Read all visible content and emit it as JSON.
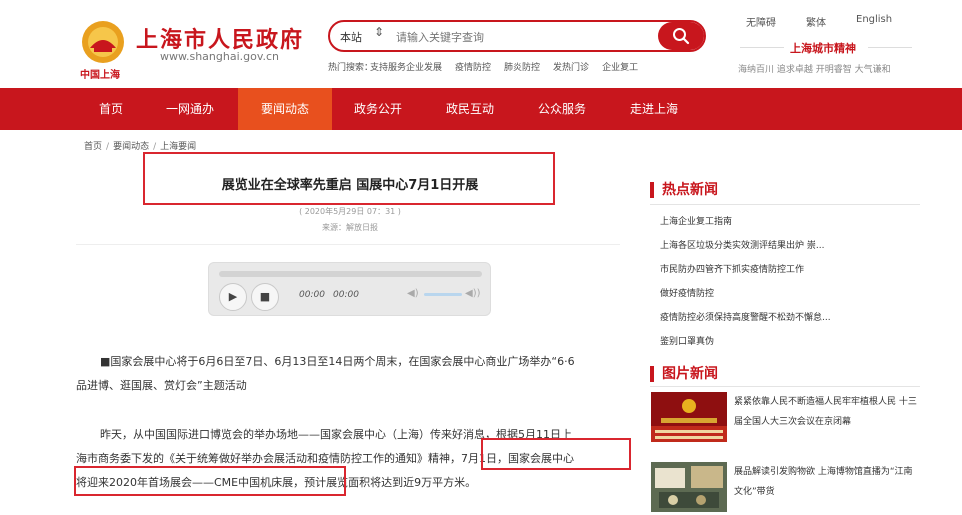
{
  "header": {
    "site_title": "上海市人民政府",
    "site_url": "www.shanghai.gov.cn",
    "emblem_caption": "中国上海",
    "search": {
      "scope": "本站",
      "placeholder": "请输入关键字查询",
      "hot_label": "热门搜索：",
      "hot_links": [
        "支持服务企业发展",
        "疫情防控",
        "肺炎防控",
        "发热门诊",
        "企业复工"
      ]
    },
    "top_links": [
      "无障碍",
      "繁体",
      "English"
    ],
    "spirit_title": "上海城市精神",
    "spirit_text": "海纳百川 追求卓越 开明睿智 大气谦和"
  },
  "nav": {
    "items": [
      "首页",
      "一网通办",
      "要闻动态",
      "政务公开",
      "政民互动",
      "公众服务",
      "走进上海"
    ],
    "active": "要闻动态"
  },
  "breadcrumb": [
    "首页",
    "要闻动态",
    "上海要闻"
  ],
  "article": {
    "title": "展览业在全球率先重启 国展中心7月1日开展",
    "date": "( 2020年5月29日 07：31 )",
    "source": "来源：解放日报",
    "player": {
      "current_time": "00:00",
      "duration": "00:00"
    },
    "p1_line1": "■国家会展中心将于6月6日至7日、6月13日至14日两个周末，在国家会展中心商业广场举办“6·6",
    "p1_line2": "品进博、逛国展、赏灯会”主题活动",
    "p2_line1": "昨天，从中国国际进口博览会的举办场地——国家会展中心（上海）传来好消息，根据5月11日上",
    "p2_line2": "海市商务委下发的《关于统筹做好举办会展活动和疫情防控工作的通知》精神，7月1日，国家会展中心",
    "p2_line3": "将迎来2020年首场展会——CME中国机床展，预计展览面积将达到近9万平方米。"
  },
  "sidebar": {
    "hot_news_title": "热点新闻",
    "hot_news": [
      "上海企业复工指南",
      "上海各区垃圾分类实效测评结果出炉 崇...",
      "市民防办四管齐下抓实疫情防控工作",
      "做好疫情防控",
      "疫情防控必须保持高度警醒不松劲不懈怠...",
      "鉴别口罩真伪"
    ],
    "picture_news_title": "图片新闻",
    "picture_news": [
      "紧紧依靠人民不断造福人民牢牢植根人民 十三届全国人大三次会议在京闭幕",
      "展品解读引发购物欲 上海博物馆直播为“江南文化”带货"
    ]
  },
  "colors": {
    "brand_red": "#c8161d",
    "nav_active": "#e8501e",
    "annotation_box": "#d9262f"
  }
}
